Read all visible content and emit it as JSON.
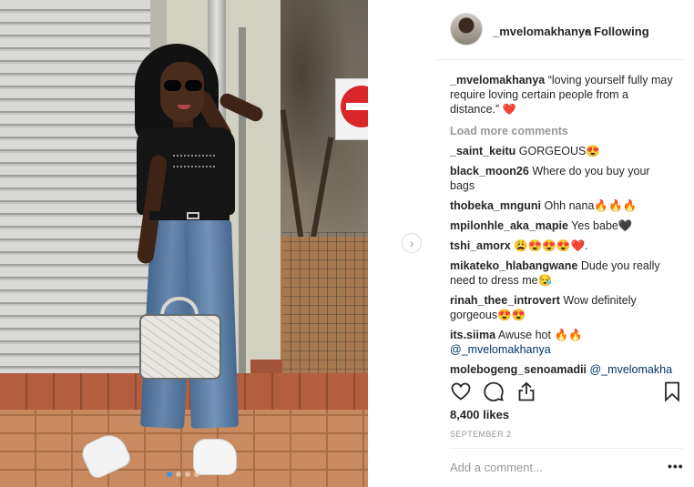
{
  "post": {
    "carousel": {
      "total_slides": 4,
      "active_slide": 1,
      "next_icon": "›"
    },
    "header": {
      "username": "_mvelomakhanya",
      "separator": "•",
      "follow_status": "Following"
    },
    "caption": {
      "username": "_mvelomakhanya",
      "text": "“loving yourself fully may require loving certain people from a distance.” ",
      "emoji": "❤️"
    },
    "load_more_label": "Load more comments",
    "comments": [
      {
        "username": "_saint_keitu",
        "text": "GORGEOUS😍"
      },
      {
        "username": "black_moon26",
        "text": "Where do you buy your bags"
      },
      {
        "username": "thobeka_mnguni",
        "text": "Ohh nana🔥🔥🔥"
      },
      {
        "username": "mpilonhle_aka_mapie",
        "text": "Yes babe🖤"
      },
      {
        "username": "tshi_amorx",
        "text": "😩😍😍😍❤️."
      },
      {
        "username": "mikateko_hlabangwane",
        "text": "Dude you really need to dress me😪"
      },
      {
        "username": "rinah_thee_introvert",
        "text": "Wow definitely gorgeous😍😍"
      },
      {
        "username": "its.siima",
        "text": "Awuse hot 🔥🔥",
        "mention": "@_mvelomakhanya"
      },
      {
        "username": "molebogeng_senoamadii",
        "text": "",
        "mention": "@_mvelomakha"
      }
    ],
    "likes": "8,400 likes",
    "date": "SEPTEMBER 2",
    "add_comment_placeholder": "Add a comment...",
    "more_options": "•••",
    "icons": {
      "like": "heart-icon",
      "comment": "comment-icon",
      "share": "share-icon",
      "save": "bookmark-icon"
    }
  }
}
